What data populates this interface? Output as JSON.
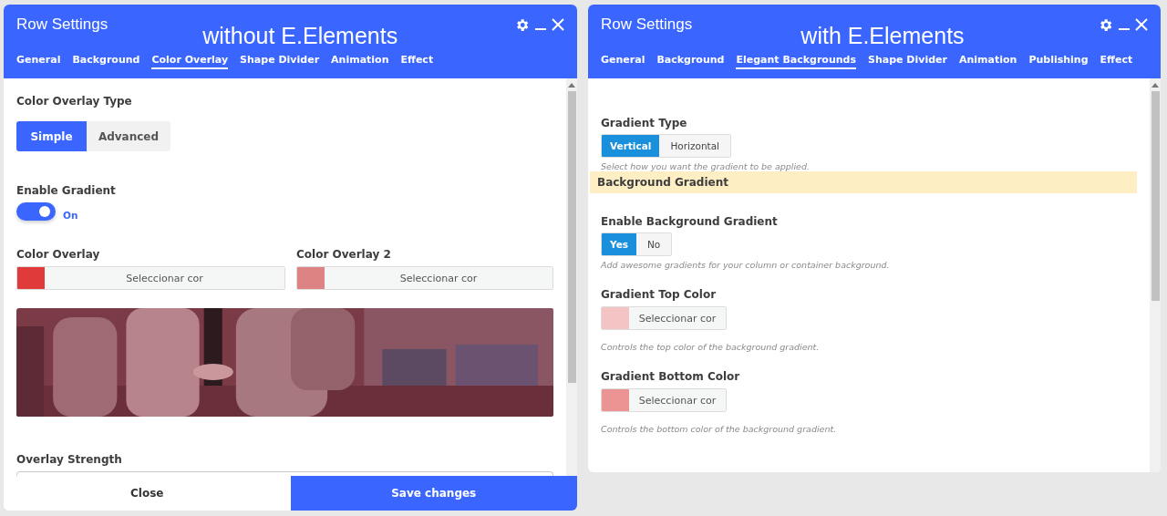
{
  "panels": [
    {
      "title": "Row Settings",
      "caption": "without E.Elements",
      "tabs": [
        {
          "label": "General",
          "selected": false
        },
        {
          "label": "Background",
          "selected": false
        },
        {
          "label": "Color Overlay",
          "selected": true
        },
        {
          "label": "Shape Divider",
          "selected": false
        },
        {
          "label": "Animation",
          "selected": false
        },
        {
          "label": "Effect",
          "selected": false
        }
      ],
      "fields": [
        {
          "kind": "segmented",
          "label": "Color Overlay Type",
          "options": [
            {
              "label": "Simple",
              "selected": true
            },
            {
              "label": "Advanced",
              "selected": false
            }
          ]
        },
        {
          "kind": "toggle",
          "label": "Enable Gradient",
          "on": true,
          "state_label": "On"
        },
        {
          "kind": "color_row",
          "pickers": [
            {
              "label": "Color Overlay",
              "color": "#e03a3a",
              "button": "Seleccionar cor"
            },
            {
              "label": "Color Overlay 2",
              "color": "#de8383",
              "button": "Seleccionar cor"
            }
          ]
        },
        {
          "kind": "picture"
        },
        {
          "kind": "input",
          "label": "Overlay Strength"
        }
      ],
      "footer": [
        {
          "label": "Close",
          "kind": "secondary"
        },
        {
          "label": "Save changes",
          "kind": "primary"
        }
      ]
    },
    {
      "title": "Row Settings",
      "caption": "with E.Elements",
      "tabs": [
        {
          "label": "General",
          "selected": false
        },
        {
          "label": "Background",
          "selected": false
        },
        {
          "label": "Elegant Backgrounds",
          "selected": true
        },
        {
          "label": "Shape Divider",
          "selected": false
        },
        {
          "label": "Animation",
          "selected": false
        },
        {
          "label": "Publishing",
          "selected": false
        },
        {
          "label": "Effect",
          "selected": false
        }
      ],
      "fields": [
        {
          "kind": "button_group",
          "label": "Gradient Type",
          "options": [
            {
              "label": "Vertical",
              "selected": true
            },
            {
              "label": "Horizontal",
              "selected": false
            }
          ],
          "hint": "Select how you want the gradient to be applied."
        },
        {
          "kind": "section",
          "label": "Background Gradient"
        },
        {
          "kind": "button_group",
          "label": "Enable Background Gradient",
          "options": [
            {
              "label": "Yes",
              "selected": true
            },
            {
              "label": "No",
              "selected": false
            }
          ],
          "hint": "Add awesome gradients for your column or container background."
        },
        {
          "kind": "color",
          "label": "Gradient Top Color",
          "color": "#f4c3c3",
          "button": "Seleccionar cor",
          "hint": "Controls the top color of the background gradient."
        },
        {
          "kind": "color",
          "label": "Gradient Bottom Color",
          "color": "#ec9494",
          "button": "Seleccionar cor",
          "hint": "Controls the bottom color of the background gradient."
        }
      ]
    }
  ]
}
